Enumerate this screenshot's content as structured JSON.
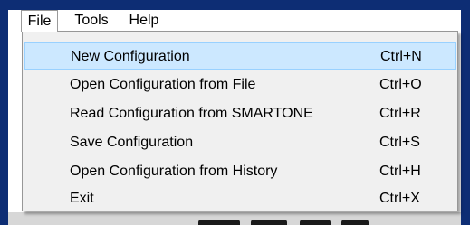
{
  "menubar": {
    "items": [
      {
        "label": "File"
      },
      {
        "label": "Tools"
      },
      {
        "label": "Help"
      }
    ]
  },
  "file_menu": {
    "items": [
      {
        "label": "New Configuration",
        "shortcut": "Ctrl+N",
        "highlighted": true
      },
      {
        "label": "Open Configuration from File",
        "shortcut": "Ctrl+O"
      },
      {
        "label": "Read Configuration from SMARTONE",
        "shortcut": "Ctrl+R"
      },
      {
        "label": "Save Configuration",
        "shortcut": "Ctrl+S"
      },
      {
        "label": "Open Configuration from History",
        "shortcut": "Ctrl+H"
      },
      {
        "label": "Exit",
        "shortcut": "Ctrl+X"
      }
    ]
  },
  "colors": {
    "window_frame": "#0d2d74",
    "menu_background": "#f0f0f0",
    "highlight_fill": "#cce8ff",
    "highlight_border": "#99d1ff"
  }
}
